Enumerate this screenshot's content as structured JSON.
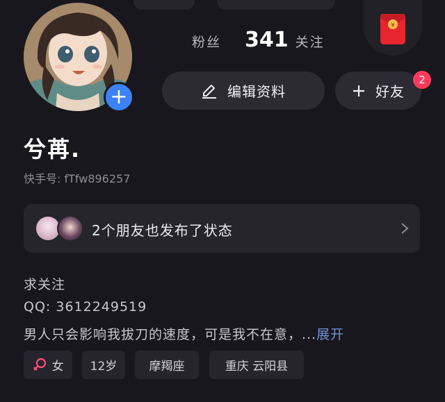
{
  "profile": {
    "stats": {
      "fans_label": "粉丝",
      "following_count": "341",
      "following_label": "关注"
    },
    "edit_button_label": "编辑资料",
    "add_friend_label": "好友",
    "friend_badge": "2",
    "nickname": "兮苒.",
    "kuaishou_id": "快手号: fTfw896257",
    "friends_status": "2个朋友也发布了状态",
    "bio": {
      "line1": "求关注",
      "line2": "QQ: 3612249519",
      "line3": "男人只会影响我拔刀的速度，可是我不在意，...",
      "expand": "展开"
    },
    "tags": {
      "gender": "女",
      "age": "12岁",
      "zodiac": "摩羯座",
      "location": "重庆 云阳县"
    }
  },
  "colors": {
    "background": "#18171d",
    "accent_blue": "#3c82f6",
    "badge_red": "#fe3a5c",
    "gender_icon": "#ff4f7a",
    "link": "#6f8fd6"
  },
  "icons": [
    "plus-icon",
    "edit-pencil-icon",
    "red-packet-icon",
    "chevron-right-icon",
    "female-icon"
  ]
}
